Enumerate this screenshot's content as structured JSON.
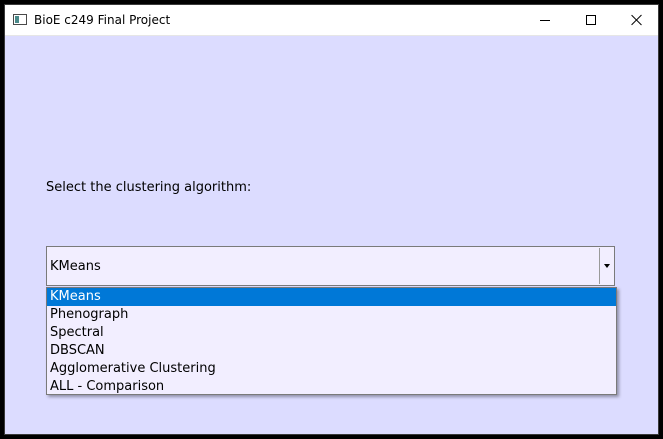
{
  "window": {
    "title": "BioE c249 Final Project",
    "controls": {
      "minimize_icon": "minimize-icon",
      "maximize_icon": "maximize-icon",
      "close_icon": "close-icon"
    }
  },
  "form": {
    "prompt": "Select the clustering algorithm:",
    "combo": {
      "selected_value": "KMeans",
      "options": [
        "KMeans",
        "Phenograph",
        "Spectral",
        "DBSCAN",
        "Agglomerative Clustering",
        "ALL - Comparison"
      ],
      "highlighted_option": "KMeans"
    }
  },
  "colors": {
    "window_background": "#dcdcff",
    "combo_background": "#f2eeff",
    "selection_highlight": "#0078d7"
  }
}
